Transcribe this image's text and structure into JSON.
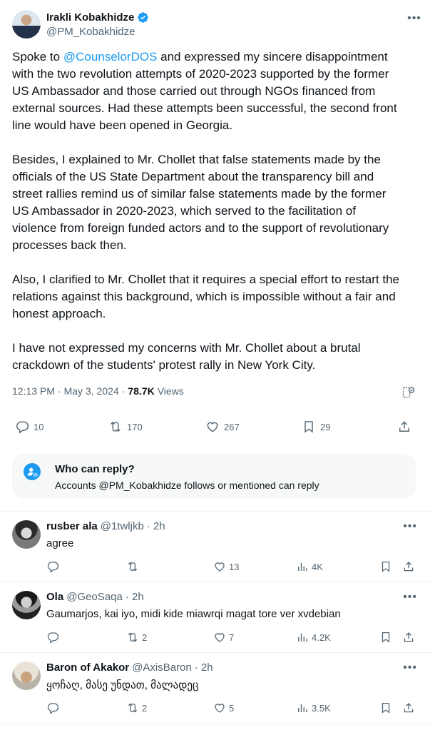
{
  "tweet": {
    "author": {
      "name": "Irakli Kobakhidze",
      "handle": "@PM_Kobakhidze",
      "verified": true
    },
    "text": {
      "p1_start": "Spoke to ",
      "p1_mention": "@CounselorDOS",
      "p1_lines": [
        " and expressed my sincere disappointment",
        "with the two revolution attempts of 2020-2023 supported by the former",
        "US Ambassador and those carried out through NGOs financed from",
        "external sources. Had these attempts been successful, the second front",
        "line would have been opened in Georgia."
      ],
      "p2_lines": [
        "Besides, I explained to Mr. Chollet that false statements made by the",
        "officials of the US State Department  about the transparency bill and",
        "street rallies remind us of similar false statements made by the former",
        "US Ambassador in 2020-2023, which served to the facilitation of",
        "violence from foreign funded actors and to the support of revolutionary",
        "processes back then."
      ],
      "p3_lines": [
        "Also, I clarified to Mr. Chollet that it requires a special effort to restart the",
        "relations against this background, which is impossible without a fair and",
        "honest approach."
      ],
      "p4_lines": [
        "I have not expressed my concerns with Mr. Chollet about a brutal",
        "crackdown of the students' protest rally in New York City."
      ]
    },
    "meta": {
      "time": "12:13 PM",
      "date": "May 3, 2024",
      "separator": "·",
      "views_count": "78.7K",
      "views_label": "Views"
    },
    "actions": {
      "replies": "10",
      "reposts": "170",
      "likes": "267",
      "bookmarks": "29"
    },
    "who_can_reply": {
      "title": "Who can reply?",
      "description": "Accounts @PM_Kobakhidze follows or mentioned can reply"
    }
  },
  "replies": [
    {
      "name": "rusber ala",
      "handle": "@1twljkb",
      "time": "· 2h",
      "text": "agree",
      "replies": "",
      "reposts": "",
      "likes": "13",
      "views": "4K"
    },
    {
      "name": "Ola",
      "handle": "@GeoSaqa",
      "time": "· 2h",
      "text": "Gaumarjos, kai iyo, midi kide miawrqi magat tore ver xvdebian",
      "replies": "",
      "reposts": "2",
      "likes": "7",
      "views": "4.2K"
    },
    {
      "name": "Baron of Akakor",
      "handle": "@AxisBaron",
      "time": "· 2h",
      "text": "ყოჩაღ, მასე უნდათ, მალადეც",
      "replies": "",
      "reposts": "2",
      "likes": "5",
      "views": "3.5K"
    }
  ],
  "colors": {
    "accent": "#1d9bf0",
    "text": "#0f1419",
    "secondary": "#536471",
    "divider": "#eff3f4",
    "card_bg": "#f7f9f9"
  },
  "icons": {
    "verified": "verified-badge-icon",
    "more": "more-icon",
    "reply": "reply-icon",
    "repost": "repost-icon",
    "like": "like-icon",
    "bookmark": "bookmark-icon",
    "share": "share-icon",
    "views": "views-icon",
    "analytics": "analytics-icon",
    "mention_user": "user-mention-icon"
  }
}
